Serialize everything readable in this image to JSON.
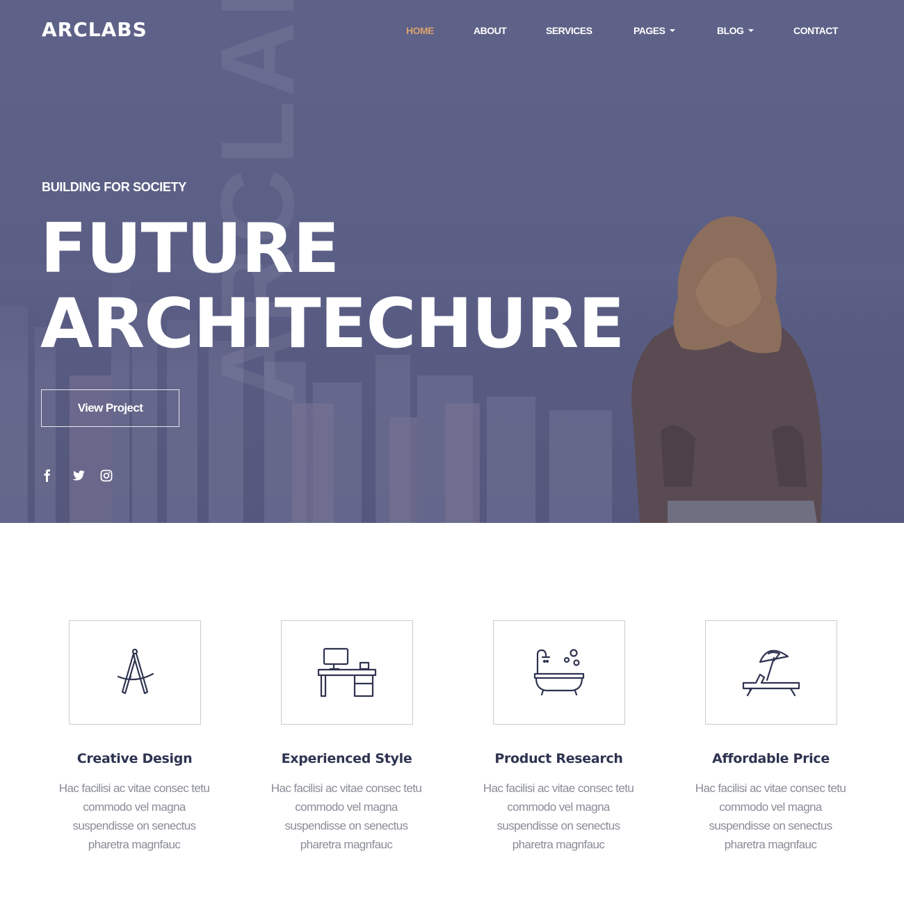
{
  "brand": {
    "logo": "ARCLABS",
    "watermark": "ARCLABS",
    "accent": "#d9a06b",
    "hero_tint": "#5d6187"
  },
  "nav": {
    "items": [
      {
        "label": "HOME",
        "active": true
      },
      {
        "label": "ABOUT"
      },
      {
        "label": "SERVICES"
      },
      {
        "label": "PAGES",
        "dropdown": true
      },
      {
        "label": "BLOG",
        "dropdown": true
      },
      {
        "label": "CONTACT"
      }
    ]
  },
  "hero": {
    "kicker": "BUILDING FOR SOCIETY",
    "headline_line1": "FUTURE",
    "headline_line2": "ARCHITECHURE",
    "cta_label": "View Project",
    "social": [
      "facebook-icon",
      "twitter-icon",
      "instagram-icon"
    ]
  },
  "features": [
    {
      "icon": "compass-icon",
      "title": "Creative Design",
      "text": "Hac facilisi ac vitae consec tetu commodo vel magna suspendisse on senectus pharetra magnfauc"
    },
    {
      "icon": "desk-computer-icon",
      "title": "Experienced Style",
      "text": "Hac facilisi ac vitae consec tetu commodo vel magna suspendisse on senectus pharetra magnfauc"
    },
    {
      "icon": "bathtub-icon",
      "title": "Product Research",
      "text": "Hac facilisi ac vitae consec tetu commodo vel magna suspendisse on senectus pharetra magnfauc"
    },
    {
      "icon": "beach-lounger-icon",
      "title": "Affordable Price",
      "text": "Hac facilisi ac vitae consec tetu commodo vel magna suspendisse on senectus pharetra magnfauc"
    }
  ]
}
